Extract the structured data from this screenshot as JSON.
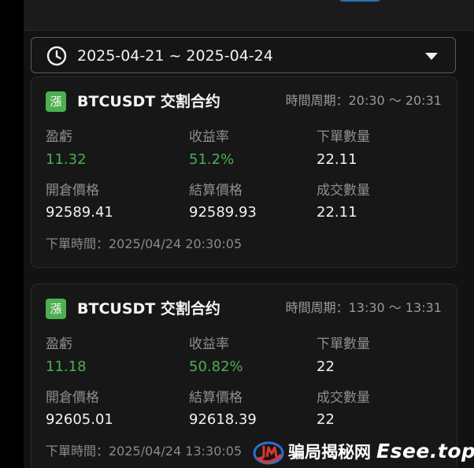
{
  "date_filter": {
    "range": "2025-04-21 ~ 2025-04-24",
    "icon": "clock-icon",
    "dropdown_icon": "caret-down-icon"
  },
  "labels": {
    "pnl": "盈虧",
    "yield": "收益率",
    "order_qty": "下單數量",
    "open_price": "開倉價格",
    "settle_price": "結算價格",
    "filled_qty": "成交數量"
  },
  "orders": [
    {
      "side": "漲",
      "symbol": "BTCUSDT 交割合约",
      "period": "時間周期：20:30 ～ 20:31",
      "pnl": "11.32",
      "yield": "51.2%",
      "order_qty": "22.11",
      "open_price": "92589.41",
      "settle_price": "92589.93",
      "filled_qty": "22.11",
      "order_time": "下單時間：2025/04/24 20:30:05"
    },
    {
      "side": "漲",
      "symbol": "BTCUSDT 交割合约",
      "period": "時間周期：13:30 ～ 13:31",
      "pnl": "11.18",
      "yield": "50.82%",
      "order_qty": "22",
      "open_price": "92605.01",
      "settle_price": "92618.39",
      "filled_qty": "22",
      "order_time": "下單時間：2025/04/24 13:30:05"
    }
  ],
  "watermark": {
    "logo_icon": "jm-logo-icon",
    "text_cn": "骗局揭秘网",
    "text_en": "Esee.top"
  },
  "colors": {
    "positive": "#4caf50",
    "background": "#121212",
    "card": "#171717",
    "muted_text": "#8e8e8e"
  }
}
